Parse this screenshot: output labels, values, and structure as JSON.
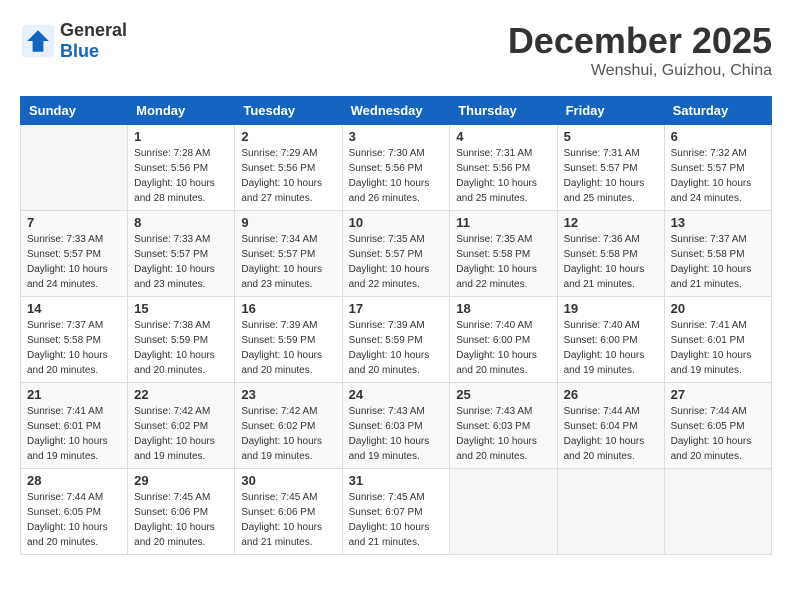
{
  "header": {
    "logo_general": "General",
    "logo_blue": "Blue",
    "month_title": "December 2025",
    "location": "Wenshui, Guizhou, China"
  },
  "calendar": {
    "days_of_week": [
      "Sunday",
      "Monday",
      "Tuesday",
      "Wednesday",
      "Thursday",
      "Friday",
      "Saturday"
    ],
    "weeks": [
      [
        {
          "day": "",
          "sunrise": "",
          "sunset": "",
          "daylight": ""
        },
        {
          "day": "1",
          "sunrise": "Sunrise: 7:28 AM",
          "sunset": "Sunset: 5:56 PM",
          "daylight": "Daylight: 10 hours and 28 minutes."
        },
        {
          "day": "2",
          "sunrise": "Sunrise: 7:29 AM",
          "sunset": "Sunset: 5:56 PM",
          "daylight": "Daylight: 10 hours and 27 minutes."
        },
        {
          "day": "3",
          "sunrise": "Sunrise: 7:30 AM",
          "sunset": "Sunset: 5:56 PM",
          "daylight": "Daylight: 10 hours and 26 minutes."
        },
        {
          "day": "4",
          "sunrise": "Sunrise: 7:31 AM",
          "sunset": "Sunset: 5:56 PM",
          "daylight": "Daylight: 10 hours and 25 minutes."
        },
        {
          "day": "5",
          "sunrise": "Sunrise: 7:31 AM",
          "sunset": "Sunset: 5:57 PM",
          "daylight": "Daylight: 10 hours and 25 minutes."
        },
        {
          "day": "6",
          "sunrise": "Sunrise: 7:32 AM",
          "sunset": "Sunset: 5:57 PM",
          "daylight": "Daylight: 10 hours and 24 minutes."
        }
      ],
      [
        {
          "day": "7",
          "sunrise": "Sunrise: 7:33 AM",
          "sunset": "Sunset: 5:57 PM",
          "daylight": "Daylight: 10 hours and 24 minutes."
        },
        {
          "day": "8",
          "sunrise": "Sunrise: 7:33 AM",
          "sunset": "Sunset: 5:57 PM",
          "daylight": "Daylight: 10 hours and 23 minutes."
        },
        {
          "day": "9",
          "sunrise": "Sunrise: 7:34 AM",
          "sunset": "Sunset: 5:57 PM",
          "daylight": "Daylight: 10 hours and 23 minutes."
        },
        {
          "day": "10",
          "sunrise": "Sunrise: 7:35 AM",
          "sunset": "Sunset: 5:57 PM",
          "daylight": "Daylight: 10 hours and 22 minutes."
        },
        {
          "day": "11",
          "sunrise": "Sunrise: 7:35 AM",
          "sunset": "Sunset: 5:58 PM",
          "daylight": "Daylight: 10 hours and 22 minutes."
        },
        {
          "day": "12",
          "sunrise": "Sunrise: 7:36 AM",
          "sunset": "Sunset: 5:58 PM",
          "daylight": "Daylight: 10 hours and 21 minutes."
        },
        {
          "day": "13",
          "sunrise": "Sunrise: 7:37 AM",
          "sunset": "Sunset: 5:58 PM",
          "daylight": "Daylight: 10 hours and 21 minutes."
        }
      ],
      [
        {
          "day": "14",
          "sunrise": "Sunrise: 7:37 AM",
          "sunset": "Sunset: 5:58 PM",
          "daylight": "Daylight: 10 hours and 20 minutes."
        },
        {
          "day": "15",
          "sunrise": "Sunrise: 7:38 AM",
          "sunset": "Sunset: 5:59 PM",
          "daylight": "Daylight: 10 hours and 20 minutes."
        },
        {
          "day": "16",
          "sunrise": "Sunrise: 7:39 AM",
          "sunset": "Sunset: 5:59 PM",
          "daylight": "Daylight: 10 hours and 20 minutes."
        },
        {
          "day": "17",
          "sunrise": "Sunrise: 7:39 AM",
          "sunset": "Sunset: 5:59 PM",
          "daylight": "Daylight: 10 hours and 20 minutes."
        },
        {
          "day": "18",
          "sunrise": "Sunrise: 7:40 AM",
          "sunset": "Sunset: 6:00 PM",
          "daylight": "Daylight: 10 hours and 20 minutes."
        },
        {
          "day": "19",
          "sunrise": "Sunrise: 7:40 AM",
          "sunset": "Sunset: 6:00 PM",
          "daylight": "Daylight: 10 hours and 19 minutes."
        },
        {
          "day": "20",
          "sunrise": "Sunrise: 7:41 AM",
          "sunset": "Sunset: 6:01 PM",
          "daylight": "Daylight: 10 hours and 19 minutes."
        }
      ],
      [
        {
          "day": "21",
          "sunrise": "Sunrise: 7:41 AM",
          "sunset": "Sunset: 6:01 PM",
          "daylight": "Daylight: 10 hours and 19 minutes."
        },
        {
          "day": "22",
          "sunrise": "Sunrise: 7:42 AM",
          "sunset": "Sunset: 6:02 PM",
          "daylight": "Daylight: 10 hours and 19 minutes."
        },
        {
          "day": "23",
          "sunrise": "Sunrise: 7:42 AM",
          "sunset": "Sunset: 6:02 PM",
          "daylight": "Daylight: 10 hours and 19 minutes."
        },
        {
          "day": "24",
          "sunrise": "Sunrise: 7:43 AM",
          "sunset": "Sunset: 6:03 PM",
          "daylight": "Daylight: 10 hours and 19 minutes."
        },
        {
          "day": "25",
          "sunrise": "Sunrise: 7:43 AM",
          "sunset": "Sunset: 6:03 PM",
          "daylight": "Daylight: 10 hours and 20 minutes."
        },
        {
          "day": "26",
          "sunrise": "Sunrise: 7:44 AM",
          "sunset": "Sunset: 6:04 PM",
          "daylight": "Daylight: 10 hours and 20 minutes."
        },
        {
          "day": "27",
          "sunrise": "Sunrise: 7:44 AM",
          "sunset": "Sunset: 6:05 PM",
          "daylight": "Daylight: 10 hours and 20 minutes."
        }
      ],
      [
        {
          "day": "28",
          "sunrise": "Sunrise: 7:44 AM",
          "sunset": "Sunset: 6:05 PM",
          "daylight": "Daylight: 10 hours and 20 minutes."
        },
        {
          "day": "29",
          "sunrise": "Sunrise: 7:45 AM",
          "sunset": "Sunset: 6:06 PM",
          "daylight": "Daylight: 10 hours and 20 minutes."
        },
        {
          "day": "30",
          "sunrise": "Sunrise: 7:45 AM",
          "sunset": "Sunset: 6:06 PM",
          "daylight": "Daylight: 10 hours and 21 minutes."
        },
        {
          "day": "31",
          "sunrise": "Sunrise: 7:45 AM",
          "sunset": "Sunset: 6:07 PM",
          "daylight": "Daylight: 10 hours and 21 minutes."
        },
        {
          "day": "",
          "sunrise": "",
          "sunset": "",
          "daylight": ""
        },
        {
          "day": "",
          "sunrise": "",
          "sunset": "",
          "daylight": ""
        },
        {
          "day": "",
          "sunrise": "",
          "sunset": "",
          "daylight": ""
        }
      ]
    ]
  }
}
